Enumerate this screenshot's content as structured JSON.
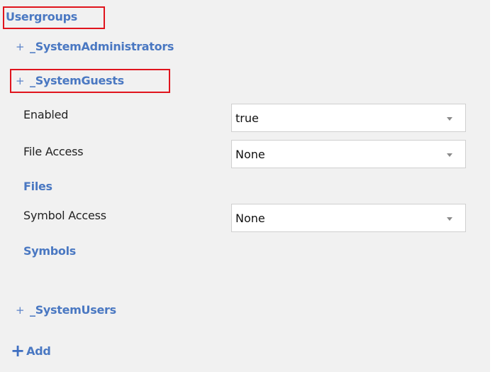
{
  "panel": {
    "title": "Usergroups"
  },
  "groups": [
    {
      "expand_symbol": "+",
      "name": "_SystemAdministrators"
    },
    {
      "expand_symbol": "+",
      "name": "_SystemGuests"
    },
    {
      "expand_symbol": "+",
      "name": "_SystemUsers"
    }
  ],
  "guest_props": {
    "enabled": {
      "label": "Enabled",
      "value": "true"
    },
    "file_access": {
      "label": "File Access",
      "value": "None"
    },
    "files_link": "Files",
    "symbol_access": {
      "label": "Symbol Access",
      "value": "None"
    },
    "symbols_link": "Symbols"
  },
  "add": {
    "icon": "+",
    "label": "Add"
  },
  "colors": {
    "link": "#4a78c2",
    "highlight": "#e0141d",
    "panel_bg": "#f1f1f1"
  },
  "icons": {
    "dropdown": "chevron-down-icon",
    "expand": "plus-icon"
  }
}
